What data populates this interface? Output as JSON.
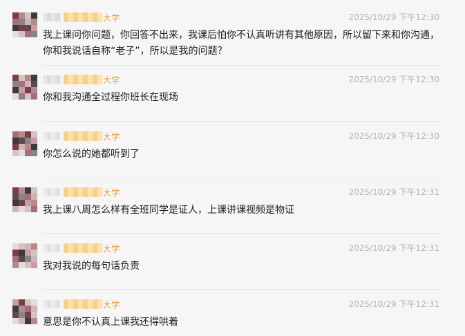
{
  "messages": [
    {
      "sender_suffix": "大学",
      "timestamp": "2025/10/29 下午12:30",
      "text": "我上课问你问题，你回答不出来，我课后怕你不认真听讲有其他原因，所以留下来和你沟通，你和我说话自称“老子”，所以是我的问题？"
    },
    {
      "sender_suffix": "大学",
      "timestamp": "2025/10/29 下午12:30",
      "text": "你和我沟通全过程你班长在现场"
    },
    {
      "sender_suffix": "大学",
      "timestamp": "2025/10/29 下午12:30",
      "text": "你怎么说的她都听到了"
    },
    {
      "sender_suffix": "大学",
      "timestamp": "2025/10/29 下午12:31",
      "text": "我上课八周怎么样有全班同学是证人，上课讲课视频是物证"
    },
    {
      "sender_suffix": "大学",
      "timestamp": "2025/10/29 下午12:31",
      "text": "我对我说的每句话负责"
    },
    {
      "sender_suffix": "大学",
      "timestamp": "2025/10/29 下午12:31",
      "text": "意思是你不认真上课我还得哄着"
    }
  ],
  "avatar_palette": [
    "#7a3e44",
    "#b58a8c",
    "#d6c2c3",
    "#3e3a3c",
    "#a0717a",
    "#8c8386",
    "#cfb3b6",
    "#e8dadb",
    "#5a4a4e",
    "#c69ea2"
  ]
}
